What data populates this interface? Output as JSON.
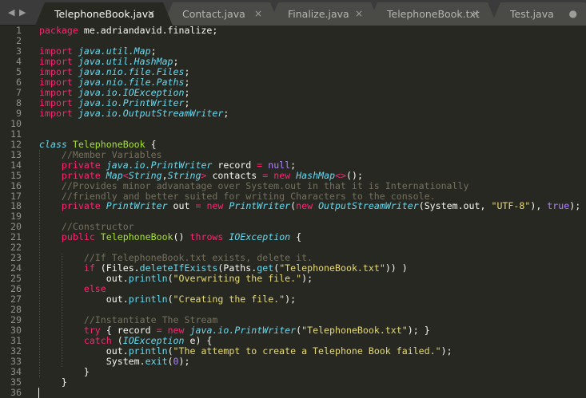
{
  "tabs": [
    {
      "label": "TelephoneBook.java",
      "active": true,
      "close": "×"
    },
    {
      "label": "Contact.java",
      "close": "×"
    },
    {
      "label": "Finalize.java",
      "close": "×"
    },
    {
      "label": "TelephoneBook.txt",
      "close": "×"
    },
    {
      "label": "Test.java",
      "close": "●"
    }
  ],
  "nav": {
    "back": "◀",
    "forward": "▶"
  },
  "colors": {
    "keyword": "#f92672",
    "type": "#66d9ef",
    "string": "#e6db74",
    "comment": "#75715e",
    "constant": "#ae81ff",
    "function": "#a6e22e",
    "background": "#272822"
  },
  "lines": [
    [
      [
        "k",
        "package"
      ],
      [
        "p",
        " me.adriandavid.finalize;"
      ]
    ],
    [],
    [
      [
        "k",
        "import"
      ],
      [
        "p",
        " "
      ],
      [
        "t",
        "java.util.Map"
      ],
      [
        "p",
        ";"
      ]
    ],
    [
      [
        "k",
        "import"
      ],
      [
        "p",
        " "
      ],
      [
        "t",
        "java.util.HashMap"
      ],
      [
        "p",
        ";"
      ]
    ],
    [
      [
        "k",
        "import"
      ],
      [
        "p",
        " "
      ],
      [
        "t",
        "java.nio.file.Files"
      ],
      [
        "p",
        ";"
      ]
    ],
    [
      [
        "k",
        "import"
      ],
      [
        "p",
        " "
      ],
      [
        "t",
        "java.nio.file.Paths"
      ],
      [
        "p",
        ";"
      ]
    ],
    [
      [
        "k",
        "import"
      ],
      [
        "p",
        " "
      ],
      [
        "t",
        "java.io.IOException"
      ],
      [
        "p",
        ";"
      ]
    ],
    [
      [
        "k",
        "import"
      ],
      [
        "p",
        " "
      ],
      [
        "t",
        "java.io.PrintWriter"
      ],
      [
        "p",
        ";"
      ]
    ],
    [
      [
        "k",
        "import"
      ],
      [
        "p",
        " "
      ],
      [
        "t",
        "java.io.OutputStreamWriter"
      ],
      [
        "p",
        ";"
      ]
    ],
    [],
    [],
    [
      [
        "t",
        "class"
      ],
      [
        "p",
        " "
      ],
      [
        "f",
        "TelephoneBook"
      ],
      [
        "p",
        " {"
      ]
    ],
    [
      [
        "p",
        "    "
      ],
      [
        "c",
        "//Member Variables"
      ]
    ],
    [
      [
        "p",
        "    "
      ],
      [
        "k",
        "private"
      ],
      [
        "p",
        " "
      ],
      [
        "t",
        "java.io.PrintWriter"
      ],
      [
        "p",
        " record "
      ],
      [
        "k",
        "="
      ],
      [
        "p",
        " "
      ],
      [
        "n",
        "null"
      ],
      [
        "p",
        ";"
      ]
    ],
    [
      [
        "p",
        "    "
      ],
      [
        "k",
        "private"
      ],
      [
        "p",
        " "
      ],
      [
        "t",
        "Map"
      ],
      [
        "k",
        "<"
      ],
      [
        "t",
        "String"
      ],
      [
        "p",
        ","
      ],
      [
        "t",
        "String"
      ],
      [
        "k",
        ">"
      ],
      [
        "p",
        " contacts "
      ],
      [
        "k",
        "="
      ],
      [
        "p",
        " "
      ],
      [
        "k",
        "new"
      ],
      [
        "p",
        " "
      ],
      [
        "t",
        "HashMap"
      ],
      [
        "k",
        "<>"
      ],
      [
        "p",
        "();"
      ]
    ],
    [
      [
        "p",
        "    "
      ],
      [
        "c",
        "//Provides minor advanatage over System.out in that it is Internationally"
      ]
    ],
    [
      [
        "p",
        "    "
      ],
      [
        "c",
        "//friendly and better suited for writing Characters to the console."
      ]
    ],
    [
      [
        "p",
        "    "
      ],
      [
        "k",
        "private"
      ],
      [
        "p",
        " "
      ],
      [
        "t",
        "PrintWriter"
      ],
      [
        "p",
        " out "
      ],
      [
        "k",
        "="
      ],
      [
        "p",
        " "
      ],
      [
        "k",
        "new"
      ],
      [
        "p",
        " "
      ],
      [
        "t",
        "PrintWriter"
      ],
      [
        "p",
        "("
      ],
      [
        "k",
        "new"
      ],
      [
        "p",
        " "
      ],
      [
        "t",
        "OutputStreamWriter"
      ],
      [
        "p",
        "(System.out, "
      ],
      [
        "s",
        "\"UTF-8\""
      ],
      [
        "p",
        "), "
      ],
      [
        "n",
        "true"
      ],
      [
        "p",
        ");"
      ]
    ],
    [],
    [
      [
        "p",
        "    "
      ],
      [
        "c",
        "//Constructor"
      ]
    ],
    [
      [
        "p",
        "    "
      ],
      [
        "k",
        "public"
      ],
      [
        "p",
        " "
      ],
      [
        "f",
        "TelephoneBook"
      ],
      [
        "p",
        "() "
      ],
      [
        "k",
        "throws"
      ],
      [
        "p",
        " "
      ],
      [
        "t",
        "IOException"
      ],
      [
        "p",
        " {"
      ]
    ],
    [],
    [
      [
        "p",
        "        "
      ],
      [
        "c",
        "//If TelephoneBook.txt exists, delete it."
      ]
    ],
    [
      [
        "p",
        "        "
      ],
      [
        "k",
        "if"
      ],
      [
        "p",
        " (Files."
      ],
      [
        "fc",
        "deleteIfExists"
      ],
      [
        "p",
        "(Paths."
      ],
      [
        "fc",
        "get"
      ],
      [
        "p",
        "("
      ],
      [
        "s",
        "\"TelephoneBook.txt\""
      ],
      [
        "p",
        ")) )"
      ]
    ],
    [
      [
        "p",
        "            out."
      ],
      [
        "fc",
        "println"
      ],
      [
        "p",
        "("
      ],
      [
        "s",
        "\"Overwriting the file.\""
      ],
      [
        "p",
        ");"
      ]
    ],
    [
      [
        "p",
        "        "
      ],
      [
        "k",
        "else"
      ]
    ],
    [
      [
        "p",
        "            out."
      ],
      [
        "fc",
        "println"
      ],
      [
        "p",
        "("
      ],
      [
        "s",
        "\"Creating the file.\""
      ],
      [
        "p",
        ");"
      ]
    ],
    [],
    [
      [
        "p",
        "        "
      ],
      [
        "c",
        "//Instantiate The Stream"
      ]
    ],
    [
      [
        "p",
        "        "
      ],
      [
        "k",
        "try"
      ],
      [
        "p",
        " { record "
      ],
      [
        "k",
        "="
      ],
      [
        "p",
        " "
      ],
      [
        "k",
        "new"
      ],
      [
        "p",
        " "
      ],
      [
        "t",
        "java.io.PrintWriter"
      ],
      [
        "p",
        "("
      ],
      [
        "s",
        "\"TelephoneBook.txt\""
      ],
      [
        "p",
        "); }"
      ]
    ],
    [
      [
        "p",
        "        "
      ],
      [
        "k",
        "catch"
      ],
      [
        "p",
        " ("
      ],
      [
        "t",
        "IOException"
      ],
      [
        "p",
        " e) {"
      ]
    ],
    [
      [
        "p",
        "            out."
      ],
      [
        "fc",
        "println"
      ],
      [
        "p",
        "("
      ],
      [
        "s",
        "\"The attempt to create a Telephone Book failed.\""
      ],
      [
        "p",
        ");"
      ]
    ],
    [
      [
        "p",
        "            System."
      ],
      [
        "fc",
        "exit"
      ],
      [
        "p",
        "("
      ],
      [
        "n",
        "0"
      ],
      [
        "p",
        ");"
      ]
    ],
    [
      [
        "p",
        "        }"
      ]
    ],
    [
      [
        "p",
        "    }"
      ]
    ],
    []
  ]
}
